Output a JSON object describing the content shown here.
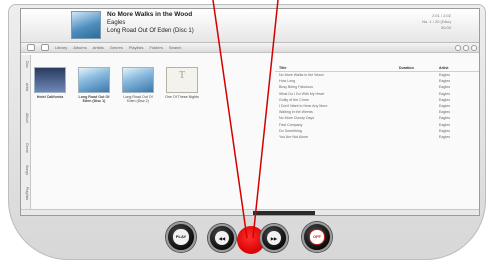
{
  "now_playing": {
    "title": "No More Walks in the Wood",
    "artist": "Eagles",
    "album": "Long Road Out Of Eden (Disc 1)",
    "meta": [
      "2:01 / 2:02",
      "No. 1 / 20 (Disc)",
      "00:00"
    ]
  },
  "toolbar": {
    "items": [
      "Library",
      "Albums",
      "Artists",
      "Genres",
      "Playlists",
      "Folders",
      "Search"
    ]
  },
  "sidebar": {
    "tabs": [
      "Disc",
      "Artist",
      "Album",
      "Genre",
      "Songs",
      "Playlists"
    ]
  },
  "albums": [
    {
      "name": "Hotel California",
      "sub": ""
    },
    {
      "name": "Long Road Out Of Eden (Disc 1)",
      "sub": ""
    },
    {
      "name": "Long Road Out Of Eden (Disc 2)",
      "sub": ""
    },
    {
      "name": "One Of These Nights",
      "sub": ""
    }
  ],
  "tracks": {
    "headers": [
      "Title",
      "Duration",
      "Artist"
    ],
    "rows": [
      {
        "title": "No More Walks in the Wood",
        "duration": "",
        "artist": "Eagles"
      },
      {
        "title": "How Long",
        "duration": "",
        "artist": "Eagles"
      },
      {
        "title": "Busy Being Fabulous",
        "duration": "",
        "artist": "Eagles"
      },
      {
        "title": "What Do I Do With My Heart",
        "duration": "",
        "artist": "Eagles"
      },
      {
        "title": "Guilty of the Crime",
        "duration": "",
        "artist": "Eagles"
      },
      {
        "title": "I Don't Want to Hear Any More",
        "duration": "",
        "artist": "Eagles"
      },
      {
        "title": "Waiting in the Weeds",
        "duration": "",
        "artist": "Eagles"
      },
      {
        "title": "No More Cloudy Days",
        "duration": "",
        "artist": "Eagles"
      },
      {
        "title": "Fast Company",
        "duration": "",
        "artist": "Eagles"
      },
      {
        "title": "Do Something",
        "duration": "",
        "artist": "Eagles"
      },
      {
        "title": "You Are Not Alone",
        "duration": "",
        "artist": "Eagles"
      }
    ]
  },
  "controls": {
    "play_label": "PLAY",
    "prev_label": "◀◀",
    "next_label": "▶▶",
    "power_label": "OFF"
  },
  "colors": {
    "pointer_line": "#d40000",
    "accent_red": "#c21e1e"
  },
  "icons": [
    "play-pause-icon",
    "previous-icon",
    "next-icon",
    "power-icon"
  ]
}
